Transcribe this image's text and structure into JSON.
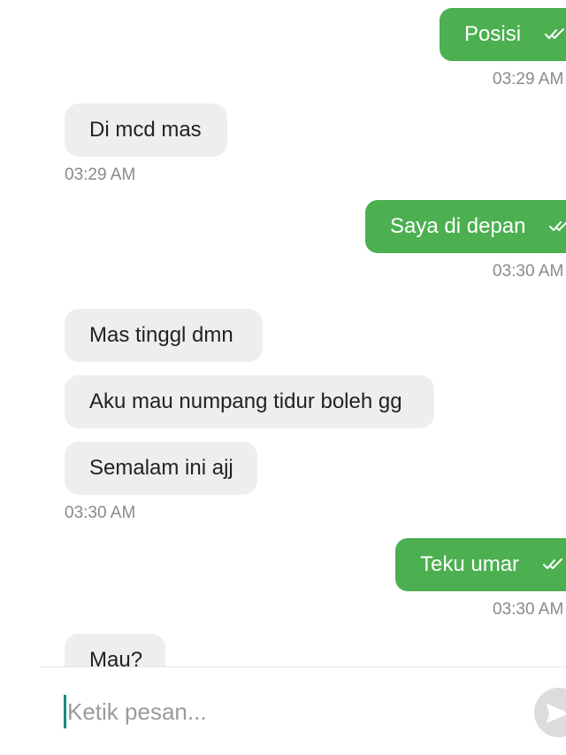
{
  "messages": [
    {
      "side": "out",
      "text": "Posisi",
      "time": "03:29 AM",
      "read_icon": "double-check-icon"
    },
    {
      "side": "in",
      "text": "Di mcd mas",
      "time": "03:29 AM"
    },
    {
      "side": "out",
      "text": "Saya di depan",
      "time": "03:30 AM",
      "read_icon": "double-check-icon"
    },
    {
      "side": "in",
      "text": "Mas tinggl dmn"
    },
    {
      "side": "in",
      "text": "Aku mau numpang tidur boleh gg"
    },
    {
      "side": "in",
      "text": "Semalam ini ajj",
      "time": "03:30 AM"
    },
    {
      "side": "out",
      "text": "Teku umar",
      "time": "03:30 AM",
      "read_icon": "double-check-icon"
    },
    {
      "side": "in",
      "text": "Mau?"
    }
  ],
  "composer": {
    "placeholder": "Ketik pesan...",
    "send_icon": "send-icon"
  },
  "colors": {
    "outgoing_bubble": "#4caf50",
    "incoming_bubble": "#eeeeee",
    "timestamp": "#8a8a8a",
    "cursor": "#1a8a7a"
  }
}
